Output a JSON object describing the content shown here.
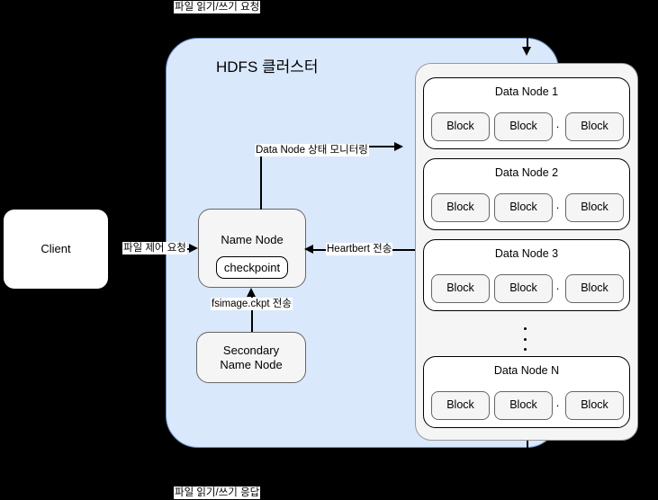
{
  "diagram": {
    "title": "HDFS 클러스터",
    "background_color": "#000000",
    "cluster_fill": "#dae8fc",
    "cluster_stroke": "#6c8ebf"
  },
  "client": {
    "label": "Client"
  },
  "name_node": {
    "label": "Name Node",
    "checkpoint_label": "checkpoint"
  },
  "secondary_name_node": {
    "label": "Secondary\nName Node",
    "line1": "Secondary",
    "line2": "Name Node"
  },
  "edges": {
    "top_request": "파일 읽기/쓰기 요청",
    "bottom_response": "파일 읽기/쓰기 응답",
    "file_control_request": "파일 제어 요청",
    "datanode_monitoring": "Data Node 상태 모니터링",
    "heartbeat": "Heartbert 전송",
    "fsimage_transfer": "fsimage.ckpt 전송"
  },
  "data_nodes": [
    {
      "title": "Data Node 1",
      "blocks": [
        "Block",
        "Block",
        "Block"
      ],
      "ellipsis": "· ·"
    },
    {
      "title": "Data Node 2",
      "blocks": [
        "Block",
        "Block",
        "Block"
      ],
      "ellipsis": "· ·"
    },
    {
      "title": "Data Node 3",
      "blocks": [
        "Block",
        "Block",
        "Block"
      ],
      "ellipsis": "· ·"
    },
    {
      "title": "Data Node N",
      "blocks": [
        "Block",
        "Block",
        "Block"
      ],
      "ellipsis": "· ·"
    }
  ]
}
